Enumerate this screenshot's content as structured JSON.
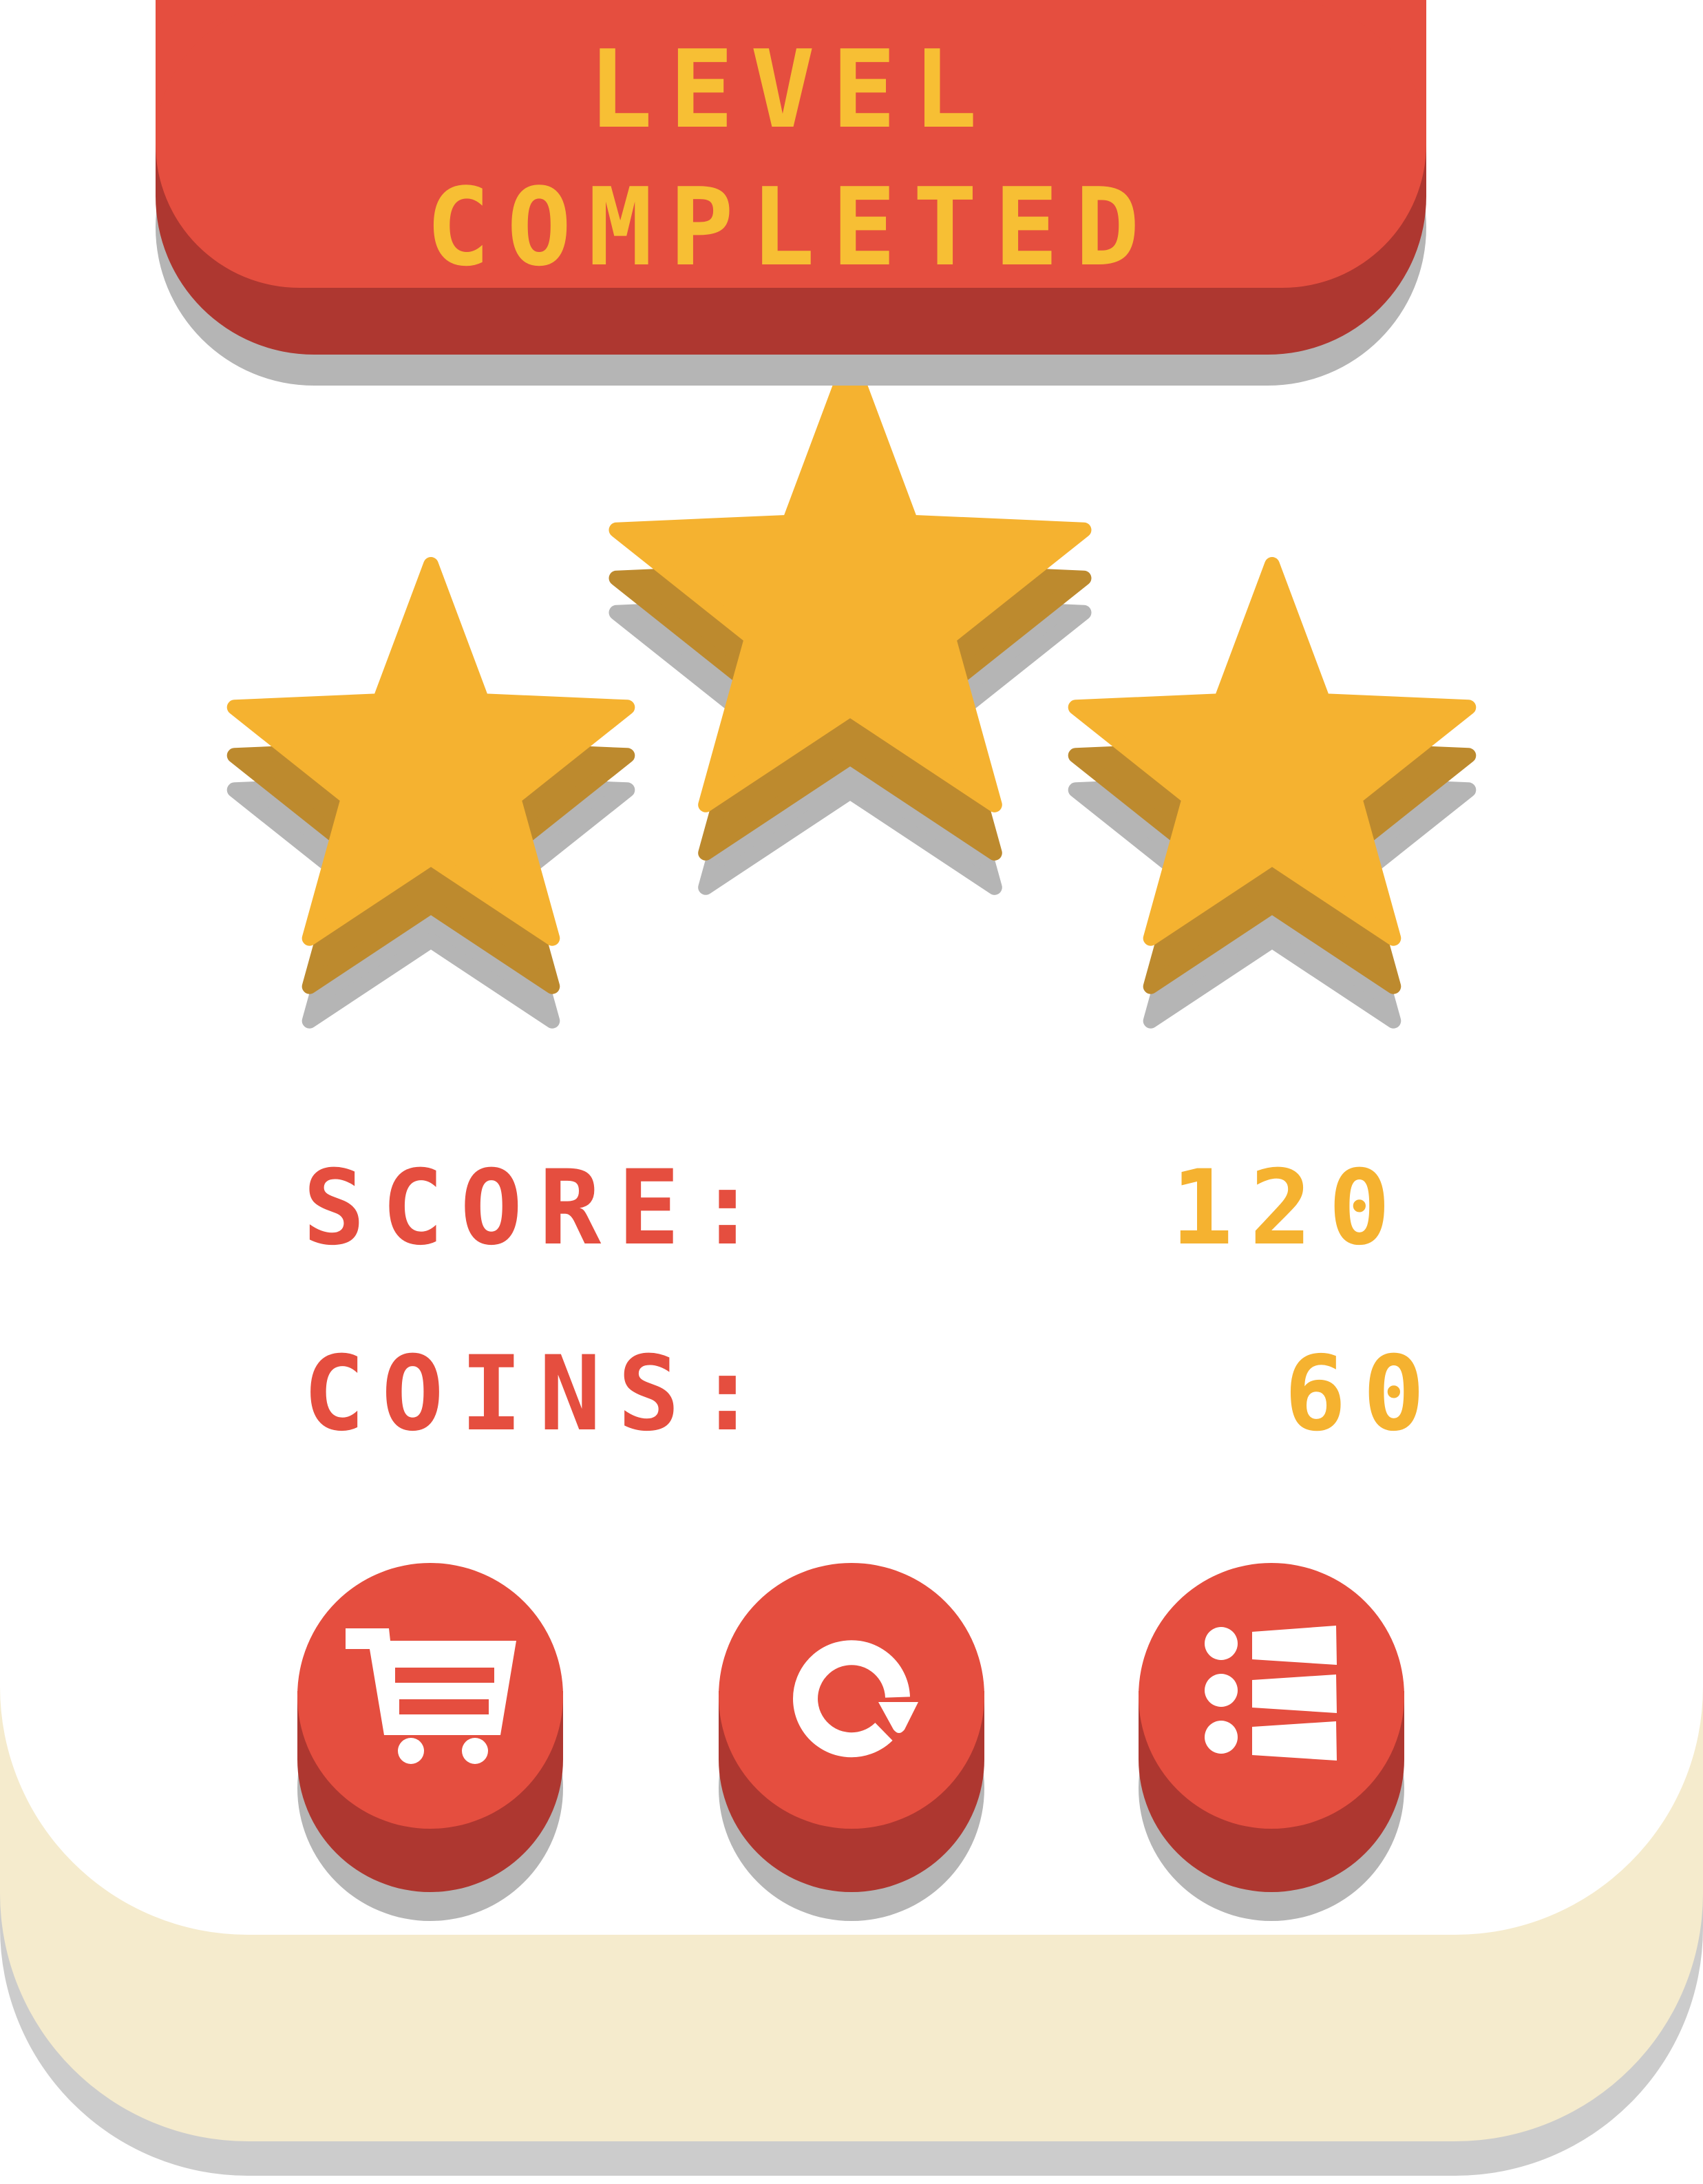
{
  "banner": {
    "line1": "LEVEL",
    "line2": "COMPLETED"
  },
  "stars": {
    "earned": 3,
    "total": 3,
    "color": "#f5b230",
    "side_color": "#bd8a2e"
  },
  "stats": {
    "score_label": "SCORE:",
    "score_value": "120",
    "coins_label": "COINS:",
    "coins_value": "60"
  },
  "buttons": {
    "shop_icon": "shopping-cart-icon",
    "restart_icon": "restart-icon",
    "menu_icon": "level-list-icon"
  },
  "colors": {
    "primary_red": "#e54e3f",
    "dark_red": "#ae3730",
    "gold": "#f7bf34",
    "cream": "#f5ebcd"
  }
}
